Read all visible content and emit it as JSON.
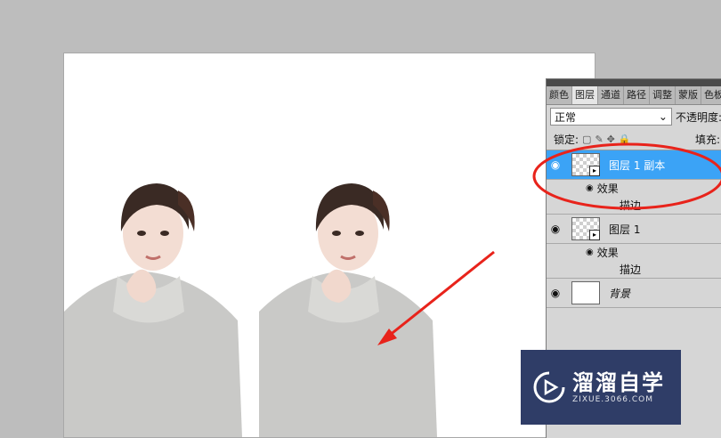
{
  "layers_panel": {
    "tabs": [
      "颜色",
      "图层",
      "通道",
      "路径",
      "调整",
      "蒙版",
      "色板"
    ],
    "active_tab": "图层",
    "blend_mode": "正常",
    "opacity_label": "不透明度:",
    "lock_label": "锁定:",
    "fill_label": "填充:",
    "layers": [
      {
        "name": "图层 1 副本",
        "selected": true,
        "effects_label": "效果",
        "effect_item": "描边"
      },
      {
        "name": "图层 1",
        "selected": false,
        "effects_label": "效果",
        "effect_item": "描边"
      },
      {
        "name": "背景",
        "selected": false
      }
    ]
  },
  "watermark": {
    "main": "溜溜自学",
    "sub": "ZIXUE.3066.COM"
  },
  "colors": {
    "selection": "#3ba3f6",
    "annotation_red": "#e8231b",
    "watermark_bg": "#2f3d67"
  }
}
